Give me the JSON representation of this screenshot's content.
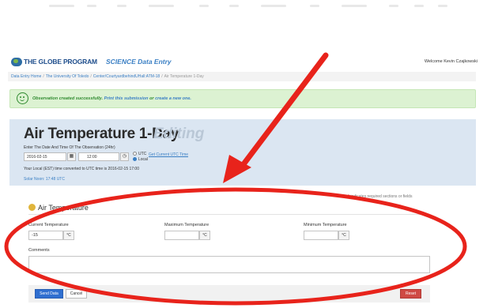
{
  "header": {
    "brand": "THE GLOBE PROGRAM",
    "subtitle": "SCIENCE Data Entry",
    "welcome": "Welcome Kevin Czajkowski"
  },
  "breadcrumb": {
    "items": [
      "Data Entry Home",
      "The University Of Toledo",
      "Center/CourtyardbehindUHall:ATM-18"
    ],
    "current": "Air Temperature 1-Day",
    "separator": "/"
  },
  "alert": {
    "message": "Observation created successfully.",
    "print_link": "Print this submission",
    "or_text": "or",
    "create_link": "create a new one."
  },
  "page": {
    "title": "Air Temperature 1-Day",
    "mode": "Editing",
    "date_prompt": "Enter The Date And Time Of The Observation (24hr)",
    "date_value": "2016-02-15",
    "time_value": "12:00",
    "utc_label": "UTC",
    "local_label": "Local",
    "utc_link": "Get Current UTC Time",
    "converted_text": "Your Local (EST) time converted to UTC time is 2016-02-15 17:00",
    "solar_noon": "Solar Noon: 17:48 UTC"
  },
  "form": {
    "required_note": "indicates required sections or fields",
    "section_title": "Air Temperature",
    "current_temp_label": "Current Temperature",
    "current_temp_value": "-15",
    "max_temp_label": "Maximum Temperature",
    "max_temp_value": "",
    "min_temp_label": "Minimum Temperature",
    "min_temp_value": "",
    "unit": "°C",
    "comments_label": "Comments",
    "comments_value": ""
  },
  "actions": {
    "send": "Send Data",
    "cancel": "Cancel",
    "reset": "Reset"
  },
  "colors": {
    "annotation": "#e8231b",
    "brand": "#1f4e8c",
    "success": "#2f8a2f"
  }
}
